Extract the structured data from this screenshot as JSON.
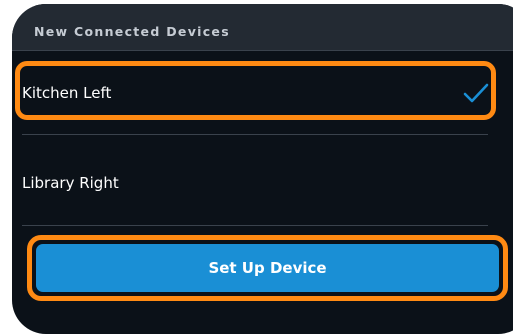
{
  "section": {
    "title": "New Connected Devices"
  },
  "devices": [
    {
      "label": "Kitchen Left",
      "selected": true
    },
    {
      "label": "Library Right",
      "selected": false
    }
  ],
  "actions": {
    "setup_label": "Set Up Device"
  },
  "icons": {
    "selected_indicator": "checkmark-icon"
  },
  "colors": {
    "focus": "#ff8a13",
    "accent": "#1a8fd5",
    "panel_background": "#0b1118",
    "header_background": "#232a33"
  }
}
